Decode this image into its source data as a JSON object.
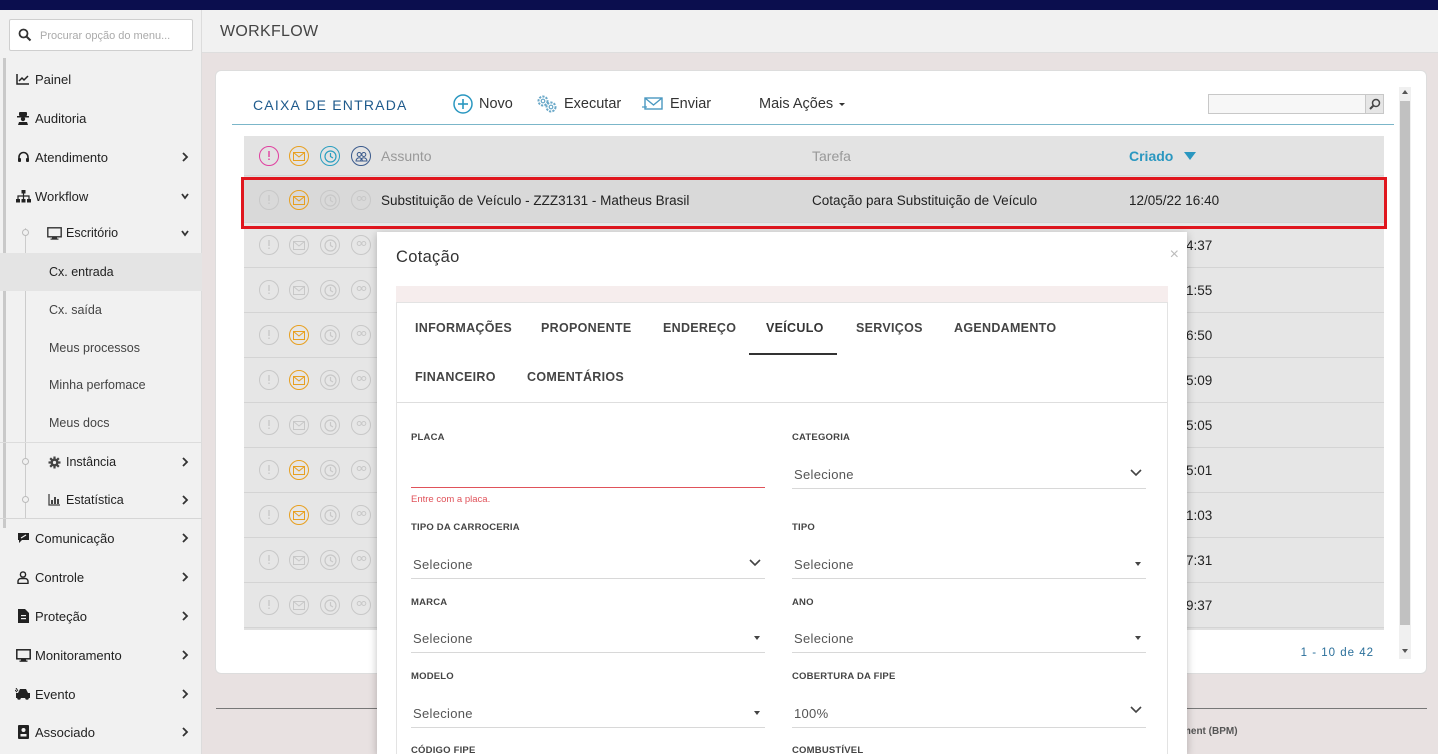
{
  "sidebar": {
    "search_placeholder": "Procurar opção do menu...",
    "items": [
      {
        "label": "Painel",
        "icon": "chart-line-icon"
      },
      {
        "label": "Auditoria",
        "icon": "user-secret-icon"
      },
      {
        "label": "Atendimento",
        "icon": "headset-icon"
      },
      {
        "label": "Workflow",
        "icon": "sitemap-icon"
      },
      {
        "label": "Escritório",
        "icon": "desktop-icon"
      },
      {
        "label": "Instância",
        "icon": "gear-icon"
      },
      {
        "label": "Estatística",
        "icon": "bar-chart-icon"
      },
      {
        "label": "Comunicação",
        "icon": "chat-icon"
      },
      {
        "label": "Controle",
        "icon": "user-icon"
      },
      {
        "label": "Proteção",
        "icon": "document-icon"
      },
      {
        "label": "Monitoramento",
        "icon": "monitor-icon"
      },
      {
        "label": "Evento",
        "icon": "car-crash-icon"
      },
      {
        "label": "Associado",
        "icon": "id-card-icon"
      }
    ],
    "sub_items": [
      "Cx. entrada",
      "Cx. saída",
      "Meus processos",
      "Minha perfomace",
      "Meus docs"
    ]
  },
  "header": {
    "title": "WORKFLOW"
  },
  "toolbar": {
    "title": "CAIXA DE ENTRADA",
    "new_label": "Novo",
    "execute_label": "Executar",
    "send_label": "Enviar",
    "more_label": "Mais Ações"
  },
  "table": {
    "columns": {
      "subject": "Assunto",
      "task": "Tarefa",
      "created": "Criado"
    },
    "rows": [
      {
        "subject": "Substituição de Veículo - ZZZ3131 - Matheus Brasil",
        "task": "Cotação para Substituição de Veículo",
        "created": "12/05/22 16:40",
        "mail": true
      },
      {
        "created": "4:37",
        "mail": false
      },
      {
        "created": "1:55",
        "mail": false
      },
      {
        "created": "6:50",
        "mail": true
      },
      {
        "created": "5:09",
        "mail": true
      },
      {
        "created": "5:05",
        "mail": false
      },
      {
        "created": "5:01",
        "mail": true
      },
      {
        "created": "1:03",
        "mail": true
      },
      {
        "created": "7:31",
        "mail": false
      },
      {
        "created": "9:37",
        "mail": false
      }
    ],
    "pager": "1 - 10 de 42"
  },
  "footer": {
    "text": "ment (BPM)"
  },
  "modal": {
    "title": "Cotação",
    "close": "×",
    "tabs": [
      "INFORMAÇÕES",
      "PROPONENTE",
      "ENDEREÇO",
      "VEÍCULO",
      "SERVIÇOS",
      "AGENDAMENTO",
      "FINANCEIRO",
      "COMENTÁRIOS"
    ],
    "active_tab": "VEÍCULO",
    "fields": {
      "placa": {
        "label": "PLACA",
        "value": "",
        "error": "Entre com a placa."
      },
      "categoria": {
        "label": "CATEGORIA",
        "value": "Selecione"
      },
      "tipo_carroceria": {
        "label": "TIPO DA CARROCERIA",
        "value": "Selecione"
      },
      "tipo": {
        "label": "TIPO",
        "value": "Selecione"
      },
      "marca": {
        "label": "MARCA",
        "value": "Selecione"
      },
      "ano": {
        "label": "ANO",
        "value": "Selecione"
      },
      "modelo": {
        "label": "MODELO",
        "value": "Selecione"
      },
      "cobertura_fipe": {
        "label": "COBERTURA DA FIPE",
        "value": "100%"
      },
      "codigo_fipe": {
        "label": "CÓDIGO FIPE"
      },
      "combustivel": {
        "label": "COMBUSTÍVEL"
      }
    }
  },
  "colors": {
    "topbar": "#0b0e4e",
    "accent_blue": "#2a97c0",
    "highlight_red": "#e0161e",
    "error_red": "#e0525a",
    "status_pink": "#e040a0",
    "status_orange": "#e8a020",
    "status_teal": "#2a9fc0",
    "status_navy": "#3a5a8c"
  }
}
